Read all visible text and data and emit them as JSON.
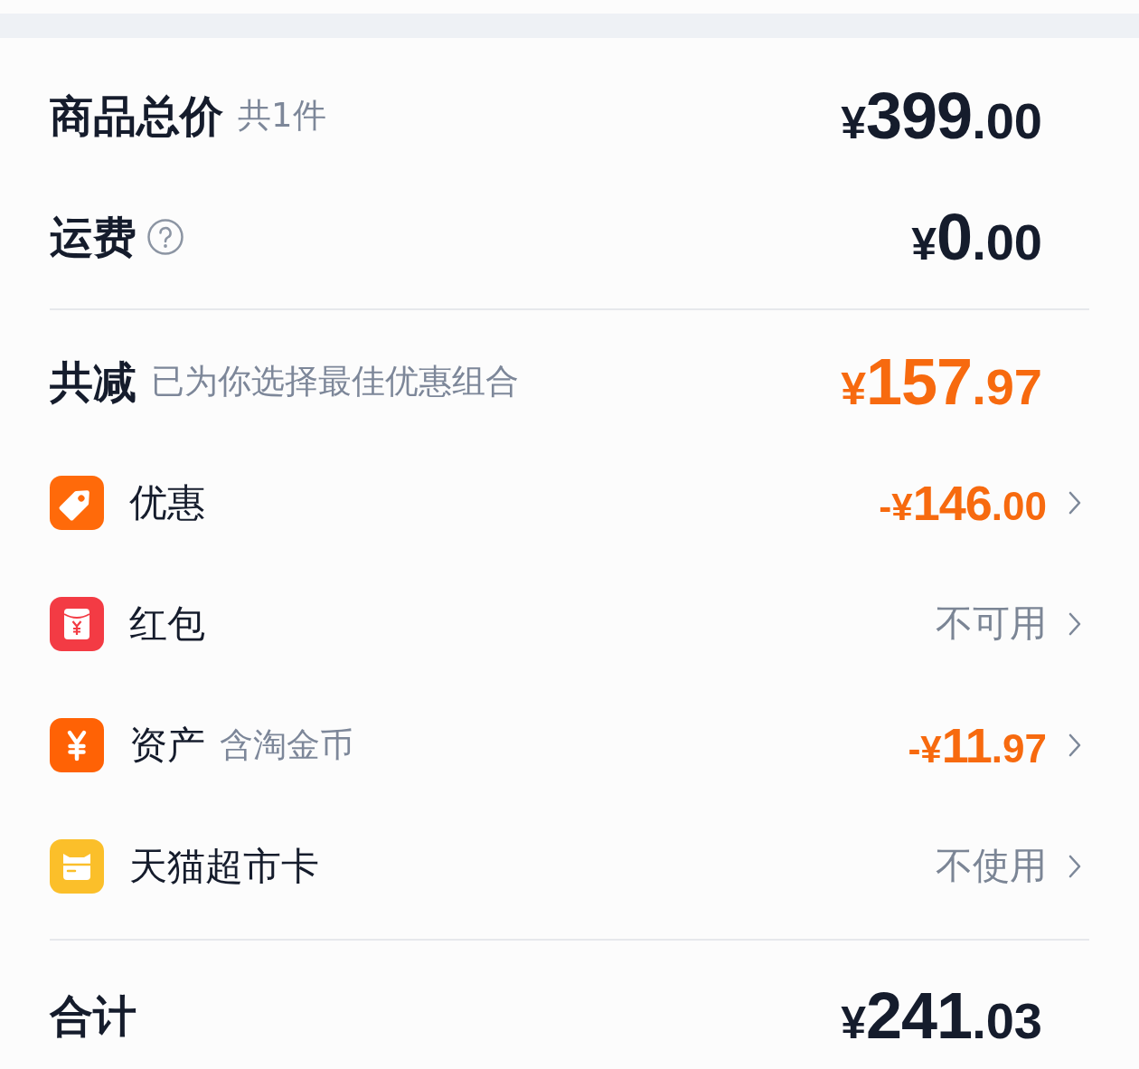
{
  "summary": [
    {
      "label": "商品总价",
      "note": "共1件",
      "amount": {
        "prefix": "¥",
        "main": "399",
        "fraction": ".00"
      },
      "discount": false
    },
    {
      "label": "运费",
      "help": true,
      "amount": {
        "prefix": "¥",
        "main": "0",
        "fraction": ".00"
      },
      "discount": false
    }
  ],
  "savings": {
    "label": "共减",
    "note": "已为你选择最佳优惠组合",
    "amount": {
      "prefix": "¥",
      "main": "157",
      "fraction": ".97"
    },
    "discount": true
  },
  "adjustments": [
    {
      "kind": "coupon",
      "label": "优惠",
      "value": {
        "kind": "amount",
        "prefix": "-¥",
        "main": "146",
        "fraction": ".00"
      }
    },
    {
      "kind": "red_packet",
      "label": "红包",
      "value": {
        "kind": "status",
        "text": "不可用"
      }
    },
    {
      "kind": "assets",
      "label": "资产",
      "note": "含淘金币",
      "value": {
        "kind": "amount",
        "prefix": "-¥",
        "main": "11",
        "fraction": ".97"
      }
    },
    {
      "kind": "store_card",
      "label": "天猫超市卡",
      "value": {
        "kind": "status",
        "text": "不使用"
      }
    }
  ],
  "total": {
    "label": "合计",
    "amount": {
      "prefix": "¥",
      "main": "241",
      "fraction": ".03"
    },
    "discount": false
  }
}
